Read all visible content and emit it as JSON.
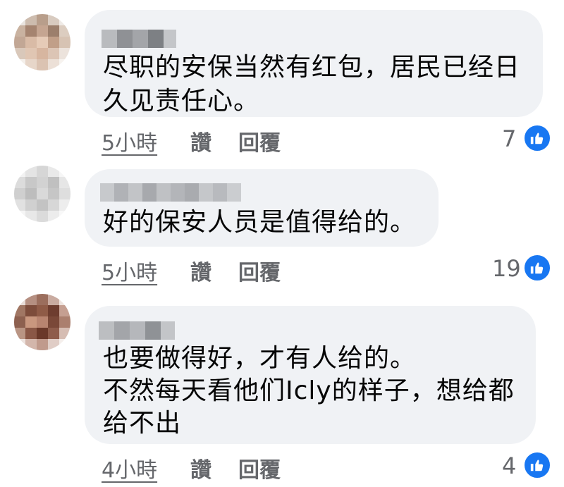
{
  "comments": [
    {
      "text": "尽职的安保当然有红包，居民已经日\n久见责任心。",
      "time": "5小時",
      "like_label": "讚",
      "reply_label": "回覆",
      "reaction_count": "7",
      "reaction_icon": "thumbs-up-icon"
    },
    {
      "text": "好的保安人员是值得给的。",
      "time": "5小時",
      "like_label": "讚",
      "reply_label": "回覆",
      "reaction_count": "19",
      "reaction_icon": "thumbs-up-icon"
    },
    {
      "text": "也要做得好，才有人给的。\n不然每天看他们Icly的样子，想给都\n给不出",
      "time": "4小時",
      "like_label": "讚",
      "reply_label": "回覆",
      "reaction_count": "4",
      "reaction_icon": "thumbs-up-icon"
    }
  ],
  "colors": {
    "bubble_bg": "#f0f2f5",
    "text": "#050505",
    "meta": "#65676b",
    "reaction_blue": "#1877f2"
  }
}
